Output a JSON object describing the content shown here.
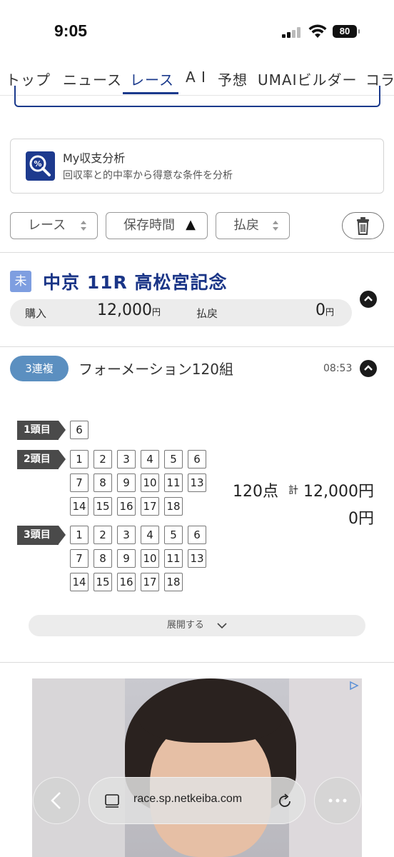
{
  "status_bar": {
    "time": "9:05",
    "battery": "80"
  },
  "nav": {
    "tabs": [
      "トップ",
      "ニュース",
      "レース",
      "A I",
      "予想",
      "UMAIビルダー",
      "コラ"
    ],
    "active_tab": "レース"
  },
  "analysis_card": {
    "title": "My収支分析",
    "description": "回収率と的中率から得意な条件を分析",
    "icon": "percent-magnifier-icon"
  },
  "filters": {
    "race": "レース",
    "saved_time": "保存時間",
    "payout": "払戻",
    "sort_indicator": "▲"
  },
  "race": {
    "status_badge": "未",
    "title": "中京 11R 高松宮記念",
    "purchase_label": "購入",
    "purchase_amount": "12,000",
    "payout_label": "払戻",
    "payout_amount": "0",
    "yen": "円"
  },
  "bet": {
    "type": "3連複",
    "name": "フォーメーション120組",
    "time": "08:53",
    "positions": [
      {
        "label": "1頭目",
        "numbers": [
          "6"
        ]
      },
      {
        "label": "2頭目",
        "numbers": [
          "1",
          "2",
          "3",
          "4",
          "5",
          "6",
          "7",
          "8",
          "9",
          "10",
          "11",
          "13",
          "14",
          "15",
          "16",
          "17",
          "18"
        ]
      },
      {
        "label": "3頭目",
        "numbers": [
          "1",
          "2",
          "3",
          "4",
          "5",
          "6",
          "7",
          "8",
          "9",
          "10",
          "11",
          "13",
          "14",
          "15",
          "16",
          "17",
          "18"
        ]
      }
    ],
    "points": "120点",
    "total_prefix": "計",
    "total_amount": "12,000円",
    "payout": "0円",
    "expand_label": "展開する"
  },
  "browser": {
    "url": "race.sp.netkeiba.com"
  },
  "colors": {
    "brand": "#1b3a8c",
    "pill": "#5b8fc0",
    "badge": "#7e9ee0"
  }
}
